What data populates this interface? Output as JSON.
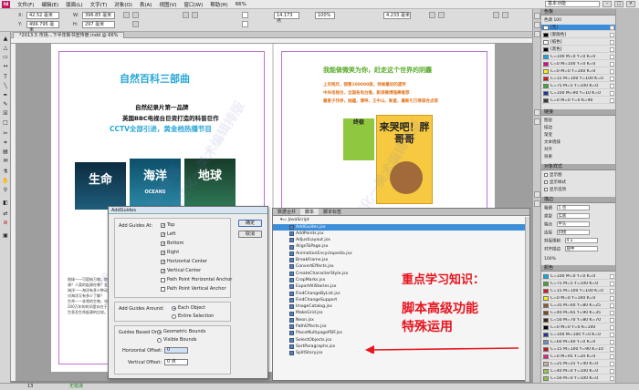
{
  "app": {
    "logo": "Id",
    "workspace": "基本功能",
    "menus": [
      "文件(F)",
      "编辑(E)",
      "版面(L)",
      "文字(T)",
      "对象(O)",
      "表(A)",
      "视图(V)",
      "窗口(W)",
      "帮助(H)"
    ],
    "zoom": "66%"
  },
  "control": {
    "x_label": "X:",
    "x_value": "42.52 毫米",
    "y_label": "Y:",
    "y_value": "499.795 毫米",
    "w_label": "W:",
    "w_value": "396.85 毫米",
    "h_label": "H:",
    "h_value": "297 毫米",
    "stroke_value": "14.173 点",
    "pct": "100%",
    "mm_value": "4.233 毫米"
  },
  "document": {
    "tab_label": "*2013.5 市场…下半年新书宣传册.indd @ 66%"
  },
  "page_left": {
    "title": "自然百科三部曲",
    "line1": "自然纪录片第一品牌",
    "line2": "英国BBC电视台巨资打造的科普巨作",
    "line3": "CCTV全部引进，黄金档热播节目",
    "books": [
      "生命",
      "海洋",
      "地球"
    ],
    "book_sub": "OCEANS",
    "body_lines": [
      "地球——可容纳万物，地球生命的起",
      "源？人类的起源在哪？全面展示了",
      "海洋——海洋有多少种动物，我们",
      "对海洋又有多少了解？",
      "生命——非常的生物，也是在生",
      "200万年的时间里存在于万物的",
      "生息及生命起源的比较。"
    ]
  },
  "page_right": {
    "headline": "我能做微笑为你，赶走这个世界的阴霾",
    "lines": [
      "上市两月，销售100000册，持续最后的遗传",
      "中央电视台、全国各电台推，新浪微博强棒推荐",
      "最爱子作序，她蕴，博坤，王中山、新星、最新引万等部合点荐"
    ],
    "book_title": "来哭吧！胖哥哥",
    "book_small": "终极"
  },
  "watermark": "湘金文化一美术编辑排版",
  "swatches": {
    "header": "色板",
    "tint_label": "色调",
    "tint_value": "100",
    "items": [
      {
        "name": "[无]",
        "color": "#ffffff"
      },
      {
        "name": "[套版色]",
        "color": "#000000"
      },
      {
        "name": "[纸色]",
        "color": "#ffffff"
      },
      {
        "name": "[黑色]",
        "color": "#000000"
      },
      {
        "name": "C=100 M=0 Y=0 K=0",
        "color": "#00aeef"
      },
      {
        "name": "C=0 M=100 Y=0 K=0",
        "color": "#ec008c"
      },
      {
        "name": "C=0 M=0 Y=100 K=0",
        "color": "#fff200"
      },
      {
        "name": "C=15 M=100 Y=100 K=0",
        "color": "#d71920"
      },
      {
        "name": "C=75 M=5 Y=100 K=0",
        "color": "#3aa935"
      },
      {
        "name": "C=100 M=90 Y=10 K=0",
        "color": "#1f3a93"
      },
      {
        "name": "C=0 M=0 Y=0 K=90",
        "color": "#3a3a3a"
      }
    ]
  },
  "panels": {
    "links_header": "链接",
    "links_items": [
      "图层",
      "描边",
      "渐变",
      "文本绕排",
      "对齐",
      "效果"
    ],
    "obj_header": "对象样式",
    "obj_items": [
      "显示图",
      "显示样式",
      "显示选项"
    ],
    "swatch2_header": "颜色",
    "swatch2_rows": [
      {
        "name": "C=100 M=0 Y=0 K=0",
        "color": "#00aeef"
      },
      {
        "name": "C=75 M=5 Y=100 K=0",
        "color": "#3aa935"
      },
      {
        "name": "C=15 M=100 Y=100 K=0",
        "color": "#d71920"
      },
      {
        "name": "C=0 M=0 Y=100 K=0",
        "color": "#fff200"
      },
      {
        "name": "C=35 M=60 Y=80 K=25",
        "color": "#8a5a2b"
      },
      {
        "name": "C=40 M=65 Y=90 K=35",
        "color": "#7a4a20"
      },
      {
        "name": "C=50 M=70 Y=80 K=70",
        "color": "#3b2414"
      },
      {
        "name": "C=0 M=0 Y=0 K=100",
        "color": "#000000"
      },
      {
        "name": "C=100 M=100 Y=0 K=0",
        "color": "#2e3192"
      },
      {
        "name": "C=60 M=40 Y=0 K=0",
        "color": "#6c8ebf"
      },
      {
        "name": "C=15 M=100 Y=90 K=10",
        "color": "#c2151e"
      },
      {
        "name": "C=0 M=95 Y=20 K=0",
        "color": "#e8207a"
      },
      {
        "name": "C=25 M=25 Y=40 K=0",
        "color": "#c4b89c"
      },
      {
        "name": "C=40 M=0 Y=100 K=0",
        "color": "#9acb3c"
      },
      {
        "name": "C=50 M=0 Y=100 K=0",
        "color": "#8bc53f"
      },
      {
        "name": "C=22 M=0 Y=100 K=0",
        "color": "#d7e021"
      }
    ],
    "stroke_header": "描边",
    "stroke_rows": [
      "粗细",
      "类型",
      "端点",
      "连接",
      "斜接限制",
      "对齐描边"
    ],
    "stroke_values": [
      "1 点",
      "实底",
      "平头",
      "斜接",
      "4 x",
      "居中"
    ],
    "percent_label": "100%"
  },
  "dialog": {
    "title": "AddGuides",
    "add_guides_at": "Add Guides At:",
    "checks": [
      "Top",
      "Left",
      "Bottom",
      "Right",
      "Horizontal Center",
      "Vertical Center",
      "Path Point Horizontal Anchor",
      "Path Point Vertical Anchor"
    ],
    "checked": [
      true,
      true,
      true,
      true,
      true,
      true,
      false,
      false
    ],
    "around_label": "Add Guides Around:",
    "around_options": [
      "Each Object",
      "Entire Selection"
    ],
    "based_label": "Guides Based On:",
    "based_options": [
      "Geometric Bounds",
      "Visible Bounds"
    ],
    "h_offset_label": "Horizontal Offset:",
    "h_offset_value": "0",
    "v_offset_label": "Vertical Offset:",
    "v_offset_value": "0 点",
    "ok": "确定",
    "cancel": "取消"
  },
  "scripts": {
    "tabs": [
      "数据合并",
      "脚本",
      "脚本标签"
    ],
    "folder": "JavaScript",
    "items": [
      "AddGuides.jsx",
      "AddPoints.jsx",
      "AdjustLayout.jsx",
      "AlignToPage.jsx",
      "AnimationEncyclopedia.jsx",
      "BreakFrame.jsx",
      "ConvertEffects.jsx",
      "CreateCharacterStyle.jsx",
      "CropMarks.jsx",
      "ExportAllStories.jsx",
      "FindChangeByList.jsx",
      "FindChangeSupport",
      "ImageCatalog.jsx",
      "MakeGrid.jsx",
      "Neon.jsx",
      "PathEffects.jsx",
      "PlaceMultipagePDF.jsx",
      "SelectObjects.jsx",
      "SortParagraphs.jsx",
      "SplitStory.jsx"
    ],
    "selected_index": 0
  },
  "annotation": {
    "line1": "重点学习知识：",
    "line2": "脚本高级功能",
    "line3": "特殊运用"
  },
  "status": {
    "page": "13",
    "state": "无错误"
  }
}
